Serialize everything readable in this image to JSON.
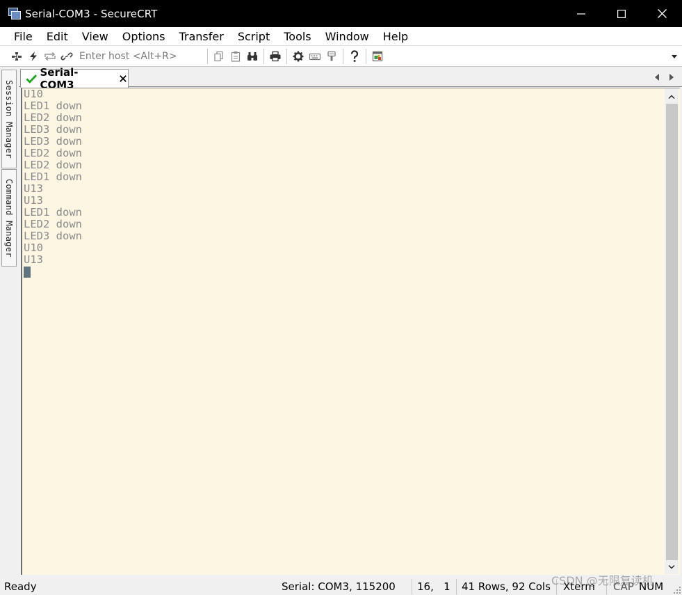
{
  "window": {
    "title": "Serial-COM3 - SecureCRT"
  },
  "menu": [
    "File",
    "Edit",
    "View",
    "Options",
    "Transfer",
    "Script",
    "Tools",
    "Window",
    "Help"
  ],
  "toolbar": {
    "host_placeholder": "Enter host <Alt+R>",
    "icons": [
      "connect-bar-icon",
      "quick-connect-icon",
      "reconnect-icon",
      "disconnect-icon",
      "copy-icon",
      "paste-icon",
      "find-icon",
      "print-icon",
      "settings-icon",
      "keymap-icon",
      "sftp-icon",
      "help-icon",
      "activator-icon"
    ]
  },
  "side_tabs": {
    "session_manager": "Session Manager",
    "command_manager": "Command Manager"
  },
  "tab": {
    "label": "Serial-COM3",
    "connected_color": "#1ea51e"
  },
  "terminal": {
    "lines": [
      "U10",
      "LED1 down",
      "LED2 down",
      "LED3 down",
      "LED3 down",
      "LED2 down",
      "LED2 down",
      "LED1 down",
      "U13",
      "U13",
      "LED1 down",
      "LED2 down",
      "LED3 down",
      "U10",
      "U13"
    ],
    "background": "#fdf6e3",
    "foreground": "#8a8a8a"
  },
  "status": {
    "ready": "Ready",
    "connection": "Serial: COM3, 115200",
    "cursor_pos": "16,   1",
    "size": "41 Rows, 92 Cols",
    "emulation": "Xterm",
    "cap": "CAP",
    "num": "NUM"
  },
  "watermark": "CSDN @无限复读机"
}
